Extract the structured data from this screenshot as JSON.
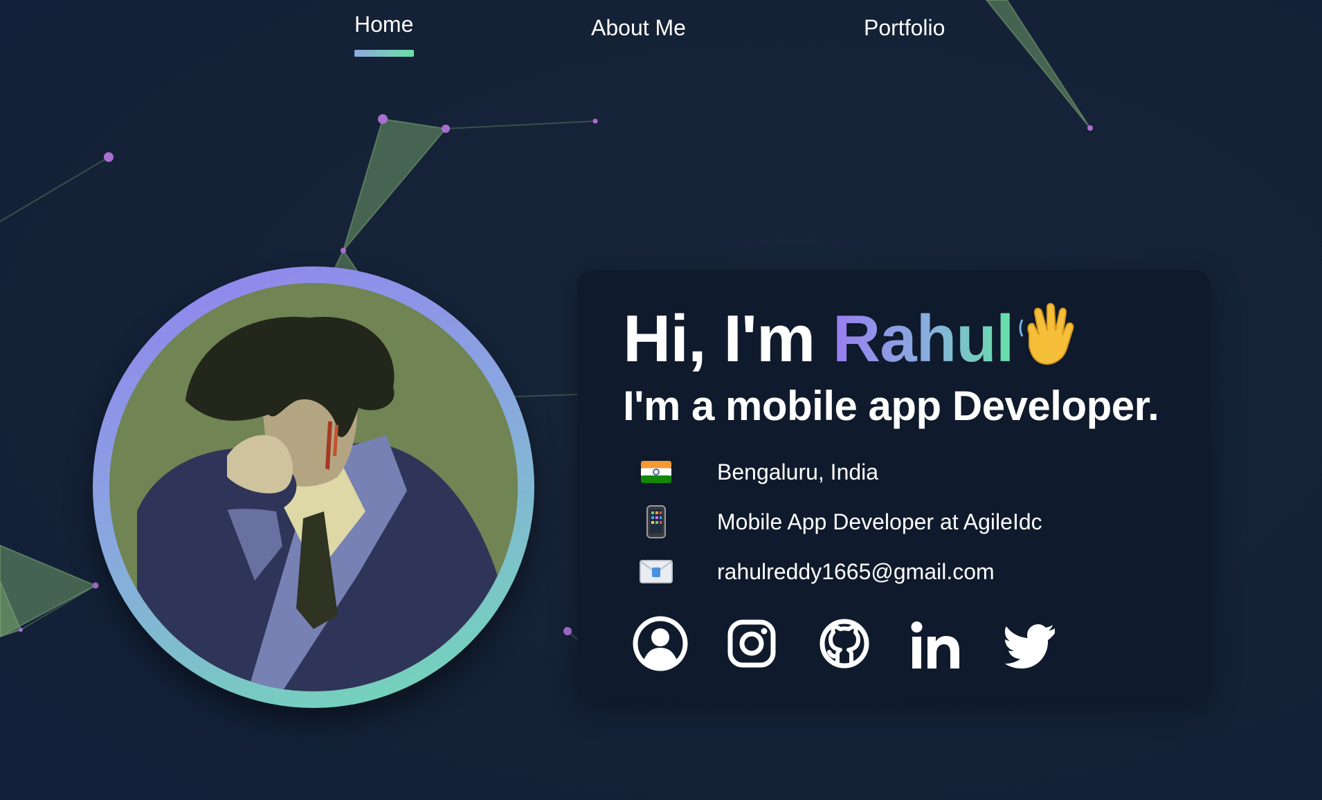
{
  "nav": {
    "items": [
      {
        "label": "Home",
        "active": true
      },
      {
        "label": "About Me",
        "active": false
      },
      {
        "label": "Portfolio",
        "active": false
      }
    ]
  },
  "intro": {
    "greeting_prefix": "Hi, I'm ",
    "name": "Rahul",
    "wave_icon": "waving-hand-icon",
    "role": "I'm a mobile app Developer."
  },
  "details": [
    {
      "icon": "india-flag-icon",
      "text": "Bengaluru, India"
    },
    {
      "icon": "mobile-phone-icon",
      "text": "Mobile App Developer at AgileIdc"
    },
    {
      "icon": "envelope-icon",
      "text": "rahulreddy1665@gmail.com"
    }
  ],
  "socials": [
    {
      "icon": "profile-icon"
    },
    {
      "icon": "instagram-icon"
    },
    {
      "icon": "github-icon"
    },
    {
      "icon": "linkedin-icon"
    },
    {
      "icon": "twitter-icon"
    }
  ],
  "colors": {
    "background": "#152236",
    "card": "#0f1a2c",
    "accent_purple": "#9a7df0",
    "accent_green": "#66e3a8",
    "network_node": "#a86fd1",
    "network_fill": "#6f9b68"
  }
}
